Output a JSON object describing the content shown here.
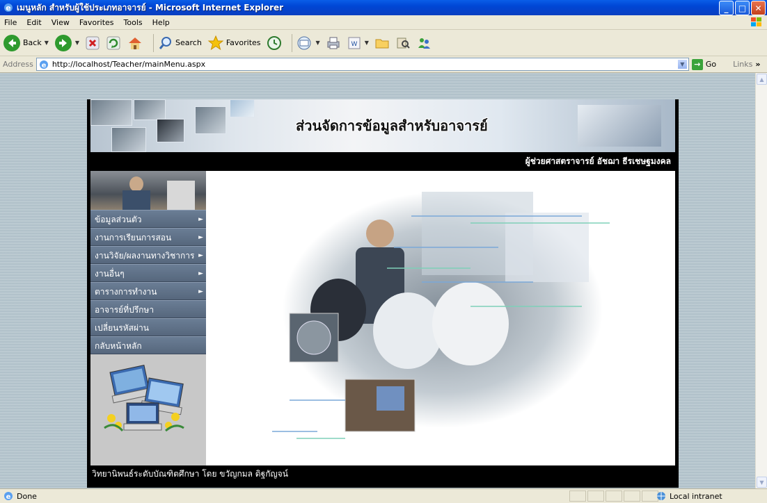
{
  "window": {
    "title": "เมนูหลัก สำหรับผู้ใช้ประเภทอาจารย์ - Microsoft Internet Explorer"
  },
  "menubar": [
    "File",
    "Edit",
    "View",
    "Favorites",
    "Tools",
    "Help"
  ],
  "toolbar": {
    "back_label": "Back",
    "search_label": "Search",
    "favorites_label": "Favorites"
  },
  "address": {
    "label": "Address",
    "url": "http://localhost/Teacher/mainMenu.aspx",
    "go_label": "Go",
    "links_label": "Links"
  },
  "page": {
    "banner_title": "ส่วนจัดการข้อมูลสำหรับอาจารย์",
    "teacher_name": "ผู้ช่วยศาสตราจารย์ อัชฌา ธีรเชษฐมงคล",
    "nav_items": [
      {
        "label": "ข้อมูลส่วนตัว",
        "submenu": true
      },
      {
        "label": "งานการเรียนการสอน",
        "submenu": true
      },
      {
        "label": "งานวิจัย/ผลงานทางวิชาการ",
        "submenu": true
      },
      {
        "label": "งานอื่นๆ",
        "submenu": true
      },
      {
        "label": "ตารางการทำงาน",
        "submenu": true
      },
      {
        "label": "อาจารย์ที่ปรึกษา",
        "submenu": false
      },
      {
        "label": "เปลี่ยนรหัสผ่าน",
        "submenu": false
      },
      {
        "label": "กลับหน้าหลัก",
        "submenu": false
      }
    ],
    "submenu_caret": "►",
    "footer": "วิทยานิพนธ์ระดับบัณฑิตศึกษา โดย ขวัญกมล ดิฐกัญจน์"
  },
  "status": {
    "text": "Done",
    "zone": "Local intranet"
  },
  "colors": {
    "titlebar": "#0a5ee8",
    "nav_item": "#5e7088",
    "page_bg": "#000000"
  }
}
